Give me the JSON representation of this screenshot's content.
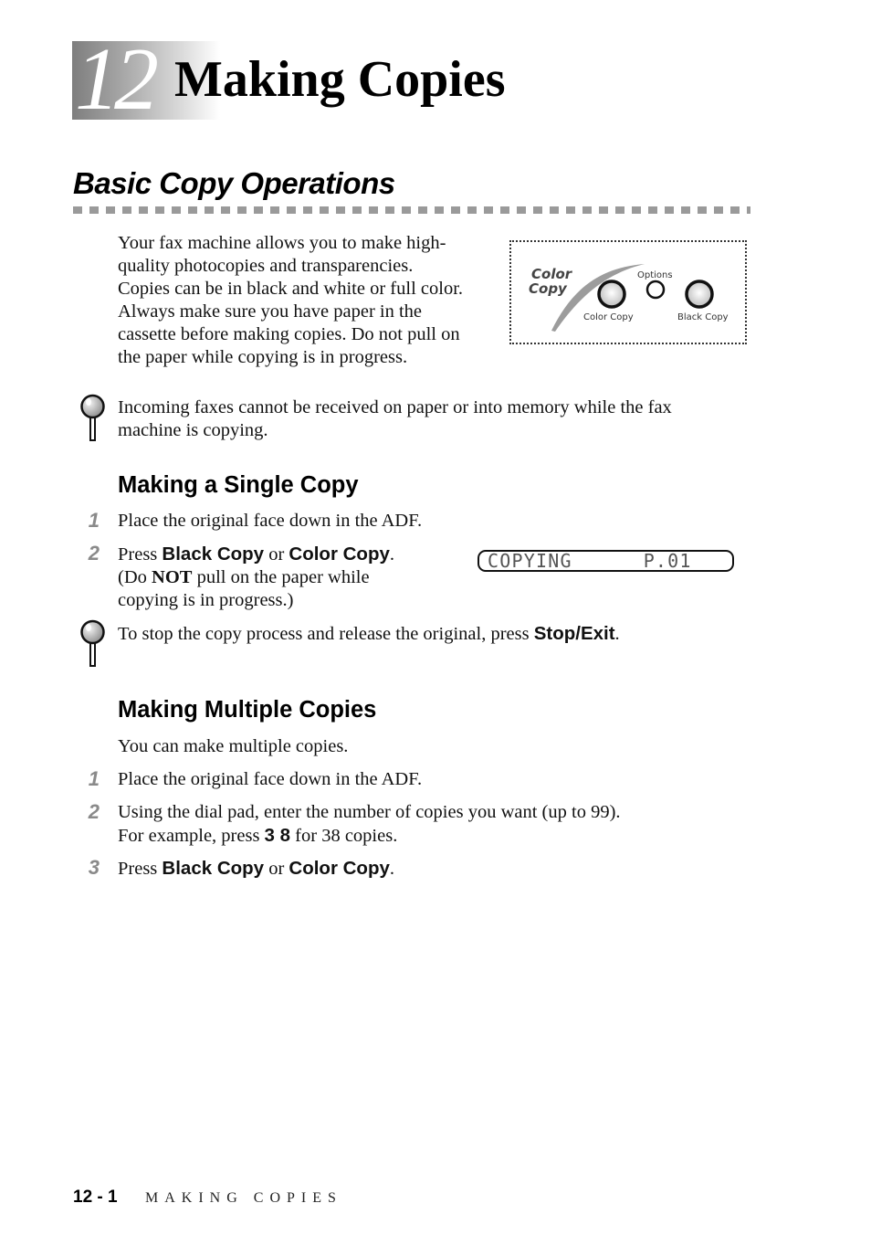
{
  "chapter": {
    "number": "12",
    "title": "Making Copies"
  },
  "section": {
    "title": "Basic Copy Operations",
    "intro_lines": [
      "Your fax machine allows you to make high-",
      "quality photocopies and transparencies.",
      "Copies can be in black and white or full color.",
      "Always make sure you have paper in the",
      "cassette before making copies.  Do not pull on",
      "the paper while copying is in progress."
    ]
  },
  "panel": {
    "logo_line1": "Color",
    "logo_line2": "Copy",
    "options_label": "Options",
    "color_copy_label": "Color Copy",
    "black_copy_label": "Black Copy"
  },
  "note1": {
    "icon": "magnifier-note-icon",
    "lines": [
      "Incoming faxes cannot be received on paper or into memory while the fax",
      "machine is copying."
    ]
  },
  "single_copy": {
    "heading": "Making a Single Copy",
    "steps": [
      {
        "num": "1",
        "text": "Place the original face down in the ADF."
      },
      {
        "num": "2",
        "press": "Press ",
        "key1": "Black Copy",
        "or": " or ",
        "key2": "Color Copy",
        "period": ".",
        "line2_a": "(Do ",
        "line2_bold": "NOT",
        "line2_b": " pull on the paper while",
        "line3": "copying is in progress.)"
      }
    ],
    "lcd": {
      "left": "COPYING",
      "right": "P.01"
    }
  },
  "note2": {
    "icon": "magnifier-note-icon",
    "text": "To stop the copy process and release the original, press ",
    "key": "Stop/Exit",
    "period": "."
  },
  "multiple_copies": {
    "heading": "Making Multiple Copies",
    "intro": "You can make multiple copies.",
    "steps": [
      {
        "num": "1",
        "text": "Place the original face down in the ADF."
      },
      {
        "num": "2",
        "line1": "Using the dial pad, enter the number of copies you want (up to 99).",
        "line2_a": "For example, press ",
        "line2_key": "3 8",
        "line2_b": " for 38 copies."
      },
      {
        "num": "3",
        "press": "Press ",
        "key1": "Black Copy",
        "or": " or ",
        "key2": "Color Copy",
        "period": "."
      }
    ]
  },
  "footer": {
    "page": "12 - 1",
    "title": "MAKING COPIES"
  }
}
